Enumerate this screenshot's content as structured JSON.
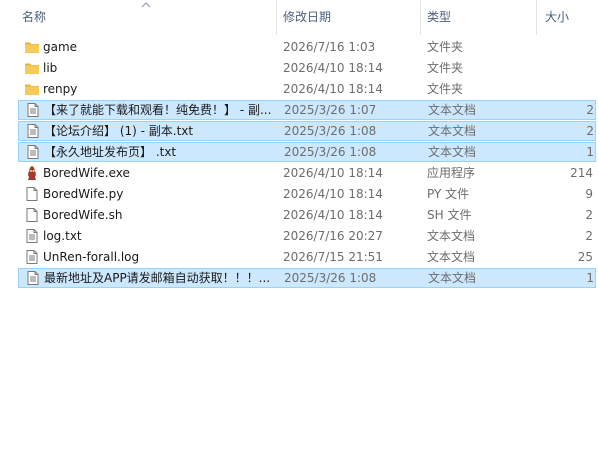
{
  "columns": {
    "name": "名称",
    "date": "修改日期",
    "type": "类型",
    "size": "大小"
  },
  "files": [
    {
      "name": "game",
      "date": "2026/7/16 1:03",
      "type": "文件夹",
      "size": "",
      "icon": "folder-icon",
      "selected": false
    },
    {
      "name": "lib",
      "date": "2026/4/10 18:14",
      "type": "文件夹",
      "size": "",
      "icon": "folder-icon",
      "selected": false
    },
    {
      "name": "renpy",
      "date": "2026/4/10 18:14",
      "type": "文件夹",
      "size": "",
      "icon": "folder-icon",
      "selected": false
    },
    {
      "name": "【来了就能下载和观看！纯免费！】 - 副...",
      "date": "2025/3/26 1:07",
      "type": "文本文档",
      "size": "2",
      "icon": "text-file-icon",
      "selected": true
    },
    {
      "name": "【论坛介绍】 (1) - 副本.txt",
      "date": "2025/3/26 1:08",
      "type": "文本文档",
      "size": "2",
      "icon": "text-file-icon",
      "selected": true
    },
    {
      "name": "【永久地址发布页】 .txt",
      "date": "2025/3/26 1:08",
      "type": "文本文档",
      "size": "1",
      "icon": "text-file-icon",
      "selected": true
    },
    {
      "name": "BoredWife.exe",
      "date": "2026/4/10 18:14",
      "type": "应用程序",
      "size": "214",
      "icon": "app-icon",
      "selected": false
    },
    {
      "name": "BoredWife.py",
      "date": "2026/4/10 18:14",
      "type": "PY 文件",
      "size": "9",
      "icon": "blank-file-icon",
      "selected": false
    },
    {
      "name": "BoredWife.sh",
      "date": "2026/4/10 18:14",
      "type": "SH 文件",
      "size": "2",
      "icon": "blank-file-icon",
      "selected": false
    },
    {
      "name": "log.txt",
      "date": "2026/7/16 20:27",
      "type": "文本文档",
      "size": "2",
      "icon": "text-file-icon",
      "selected": false
    },
    {
      "name": "UnRen-forall.log",
      "date": "2026/7/15 21:51",
      "type": "文本文档",
      "size": "25",
      "icon": "text-file-icon",
      "selected": false
    },
    {
      "name": "最新地址及APP请发邮箱自动获取！！！...",
      "date": "2025/3/26 1:08",
      "type": "文本文档",
      "size": "1",
      "icon": "text-file-icon",
      "selected": true
    }
  ],
  "colors": {
    "selection_bg": "#cce8ff",
    "selection_border": "#99d1ff",
    "header_text": "#4c607a",
    "folder": "#f3c44f"
  }
}
